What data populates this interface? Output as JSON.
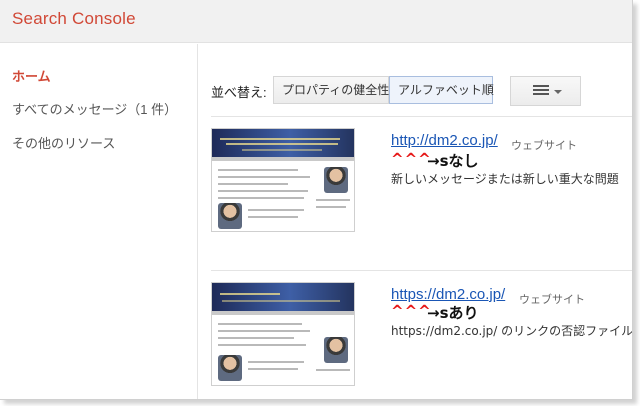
{
  "app": {
    "title": "Search Console"
  },
  "sidebar": {
    "items": [
      {
        "label": "ホーム",
        "active": true
      },
      {
        "label": "すべてのメッセージ（1 件）",
        "active": false
      },
      {
        "label": "その他のリソース",
        "active": false
      }
    ]
  },
  "toolbar": {
    "sort_label": "並べ替え:",
    "sort_options": [
      {
        "label": "プロパティの健全性",
        "selected": false
      },
      {
        "label": "アルファベット順",
        "selected": true
      }
    ],
    "view_icon": "list-icon"
  },
  "properties": [
    {
      "url": "http://dm2.co.jp/",
      "type": "ウェブサイト",
      "annotation_marks": "^^^",
      "annotation_text": "→sなし",
      "message": "新しいメッセージまたは新しい重大な問題"
    },
    {
      "url": "https://dm2.co.jp/",
      "type": "ウェブサイト",
      "annotation_marks": "^^^",
      "annotation_text": "→sあり",
      "message": "https://dm2.co.jp/ のリンクの否認ファイル"
    }
  ],
  "colors": {
    "brand": "#d14836",
    "link": "#1a56b5",
    "annotation": "#e61919"
  }
}
